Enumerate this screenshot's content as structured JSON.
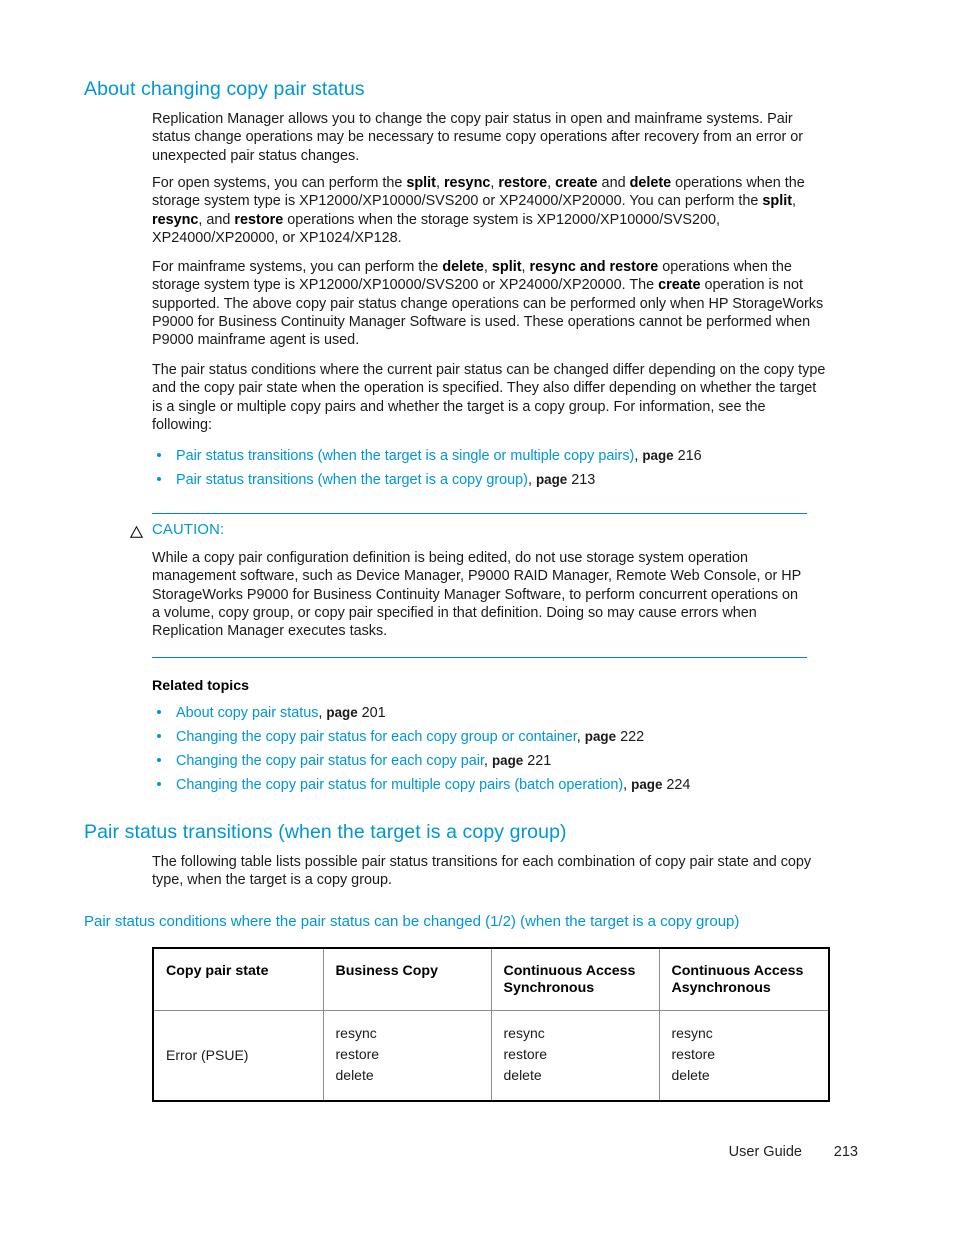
{
  "theme": {
    "heading_color": "#0096d6",
    "link_color": "#0096d6",
    "rule_color": "#0a7cba",
    "text_color": "#1a1a1a"
  },
  "section1": {
    "heading": "About changing copy pair status",
    "p1": "Replication Manager allows you to change the copy pair status in open and mainframe systems. Pair status change operations may be necessary to resume copy operations after recovery from an error or unexpected pair status changes.",
    "p2_parts": {
      "a": "For open systems, you can perform the ",
      "b1": "split",
      "c1": ", ",
      "b2": "resync",
      "c2": ", ",
      "b3": "restore",
      "c3": ", ",
      "b4": "create",
      "c4": " and ",
      "b5": "delete",
      "c5": " operations when the storage system type is XP12000/XP10000/SVS200 or XP24000/XP20000. You can perform the ",
      "b6": "split",
      "c6": ", ",
      "b7": "resync",
      "c7": ", and ",
      "b8": "restore",
      "c8": " operations when the storage system is XP12000/XP10000/SVS200, XP24000/XP20000, or XP1024/XP128."
    },
    "p3_parts": {
      "a": "For mainframe systems, you can perform the ",
      "b1": "delete",
      "c1": ", ",
      "b2": "split",
      "c2": ", ",
      "b3": "resync and restore",
      "c3": " operations when the storage system type is XP12000/XP10000/SVS200 or XP24000/XP20000. The ",
      "b4": "create",
      "c4": " operation is not supported. The above copy pair status change operations can be performed only when HP StorageWorks P9000 for Business Continuity Manager Software is used. These operations cannot be performed when P9000 mainframe agent is used."
    },
    "p4": "The pair status conditions where the current pair status can be changed differ depending on the copy type and the copy pair state when the operation is specified. They also differ depending on whether the target is a single or multiple copy pairs and whether the target is a copy group. For information, see the following:",
    "see_also": [
      {
        "link": "Pair status transitions (when the target is a single or multiple copy pairs)",
        "sep": ", ",
        "page_label": "page",
        "page_num": "216"
      },
      {
        "link": "Pair status transitions (when the target is a copy group)",
        "sep": ", ",
        "page_label": "page",
        "page_num": "213"
      }
    ]
  },
  "caution": {
    "icon": "warning-triangle-icon",
    "label": "CAUTION:",
    "text": "While a copy pair configuration definition is being edited, do not use storage system operation management software, such as Device Manager, P9000 RAID Manager, Remote Web Console, or HP StorageWorks P9000 for Business Continuity Manager Software, to perform concurrent operations on a volume, copy group, or copy pair specified in that definition. Doing so may cause errors when Replication Manager executes tasks."
  },
  "related": {
    "title": "Related topics",
    "items": [
      {
        "link": "About copy pair status",
        "sep": ", ",
        "page_label": "page",
        "page_num": "201"
      },
      {
        "link": "Changing the copy pair status for each copy group or container",
        "sep": ", ",
        "page_label": "page",
        "page_num": "222"
      },
      {
        "link": "Changing the copy pair status for each copy pair",
        "sep": ", ",
        "page_label": "page",
        "page_num": "221"
      },
      {
        "link": "Changing the copy pair status for multiple copy pairs (batch operation)",
        "sep": ", ",
        "page_label": "page",
        "page_num": "224"
      }
    ]
  },
  "section2": {
    "heading": "Pair status transitions (when the target is a copy group)",
    "p1": "The following table lists possible pair status transitions for each combination of copy pair state and copy type, when the target is a copy group.",
    "table_caption": "Pair status conditions where the pair status can be changed (1/2) (when the target is a copy group)",
    "table": {
      "headers": [
        "Copy pair state",
        "Business Copy",
        "Continuous Access Synchronous",
        "Continuous Access Asynchronous"
      ],
      "rows": [
        {
          "state": "Error (PSUE)",
          "business_copy": [
            "resync",
            "restore",
            "delete"
          ],
          "ca_sync": [
            "resync",
            "restore",
            "delete"
          ],
          "ca_async": [
            "resync",
            "restore",
            "delete"
          ]
        }
      ]
    }
  },
  "footer": {
    "guide": "User Guide",
    "page": "213"
  }
}
